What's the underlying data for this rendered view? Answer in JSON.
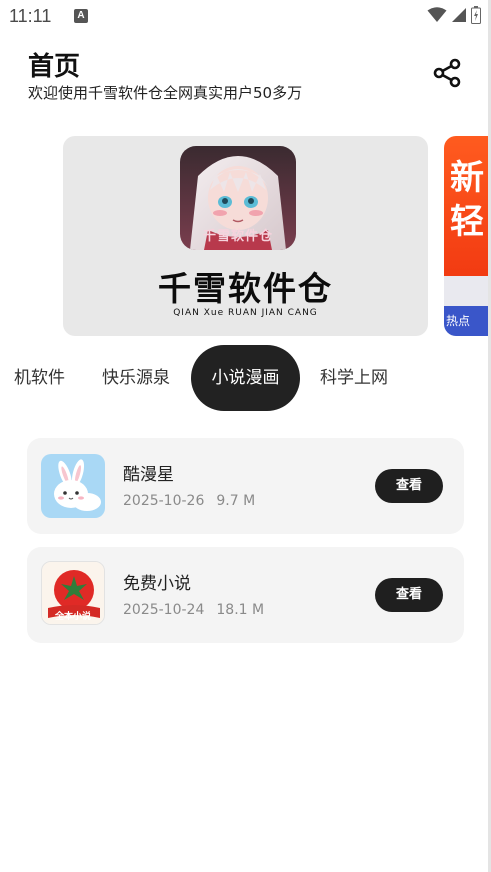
{
  "status_bar": {
    "time": "11:11",
    "notification_glyph": "A",
    "icons": [
      "wifi-icon",
      "signal-icon",
      "battery-icon"
    ]
  },
  "header": {
    "title": "首页",
    "subtitle": "欢迎使用千雪软件仓全网真实用户50多万",
    "share_icon": "share-icon"
  },
  "banners": [
    {
      "art_label": "千雪软件仓",
      "title": "千雪软件仓",
      "pinyin": "QIAN Xue RUAN JIAN CANG"
    },
    {
      "art_label": "新\n轻",
      "footer": "热点"
    }
  ],
  "tabs": [
    {
      "label": "机软件",
      "active": false
    },
    {
      "label": "快乐源泉",
      "active": false
    },
    {
      "label": "小说漫画",
      "active": true
    },
    {
      "label": "科学上网",
      "active": false
    }
  ],
  "apps": [
    {
      "name": "酷漫星",
      "date": "2025-10-26",
      "size": "9.7 M",
      "button": "查看",
      "icon": "bunny-icon"
    },
    {
      "name": "免费小说",
      "date": "2025-10-24",
      "size": "18.1 M",
      "button": "查看",
      "icon": "tomato-book-icon",
      "icon_label": "全本小说"
    }
  ],
  "colors": {
    "accent": "#222222",
    "card": "#f4f4f4",
    "banner": "#e8e8e8"
  }
}
